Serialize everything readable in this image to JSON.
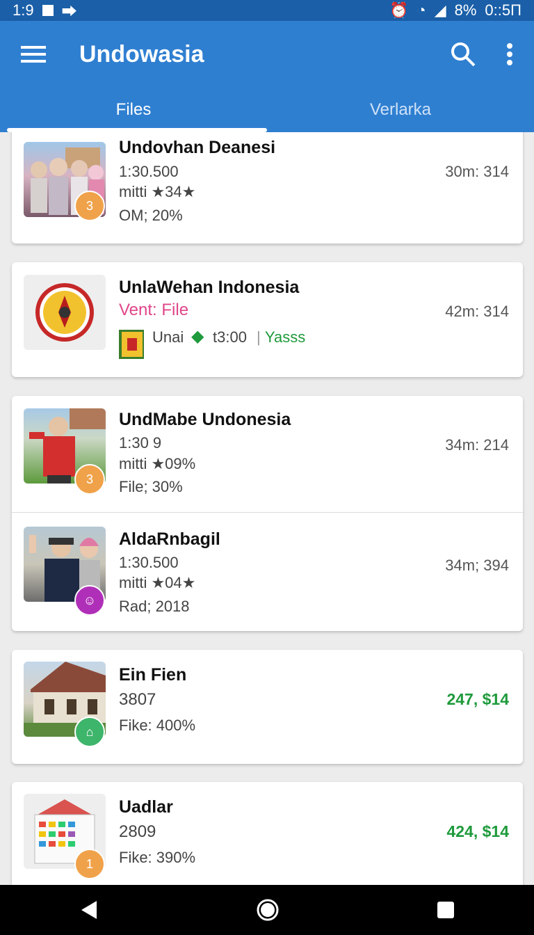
{
  "status_bar": {
    "time": "1:9",
    "battery": "8%",
    "clock": "0::5Π"
  },
  "app_bar": {
    "title": "Undowasia"
  },
  "tabs": [
    {
      "label": "Files",
      "active": true
    },
    {
      "label": "Verlarka",
      "active": false
    }
  ],
  "items": [
    {
      "name": "Undovhan Deanesi",
      "line1": "1:30.500",
      "line2": "mitti ★34★",
      "line3": "OM; 20%",
      "meta": "30m: 314",
      "badge": "3",
      "badge_color": "#f0a24a"
    },
    {
      "name": "UnlaWehan Indonesia",
      "line1": "Vent: File",
      "line2_a": "Unai",
      "line2_b": "t3:00",
      "line2_c": "Yasss",
      "meta": "42m: 314"
    },
    {
      "name": "UndMabe Undonesia",
      "line1": "1:30 9",
      "line2": "mitti ★09%",
      "line3": "File; 30%",
      "meta": "34m: 214",
      "badge": "3",
      "badge_color": "#f0a24a"
    },
    {
      "name": "AldaRnbagil",
      "line1": "1:30.500",
      "line2": "mitti ★04★",
      "line3": "Rad; 2018",
      "meta": "34m; 394",
      "badge": "☺",
      "badge_color": "#b02fb8"
    },
    {
      "name": "Ein Fien",
      "line1": "3807",
      "line3": "Fike: 400%",
      "meta": "247, $14",
      "badge": "⌂",
      "badge_color": "#3db56a"
    },
    {
      "name": "Uadlar",
      "line1": "2809",
      "line3": "Fike: 390%",
      "meta": "424, $14",
      "badge": "1",
      "badge_color": "#f0a24a"
    }
  ],
  "colors": {
    "primary": "#2f7fd1",
    "status": "#1a5fa8",
    "pink": "#e0458a",
    "green": "#1f9a3c"
  }
}
